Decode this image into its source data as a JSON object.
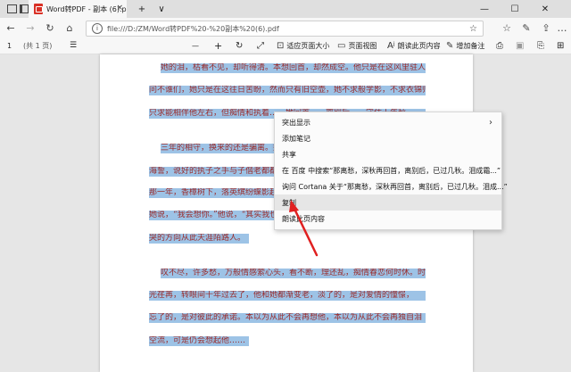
{
  "tabbar": {
    "tab_title": "Word转PDF - 副本 (6).p",
    "close_glyph": "×",
    "new_tab_glyph": "+",
    "dropdown_glyph": "∨",
    "minimize_glyph": "—",
    "maximize_glyph": "☐",
    "close_window_glyph": "✕"
  },
  "navbar": {
    "url": "file:///D:/ZM/Word转PDF%20-%20副本%20(6).pdf"
  },
  "pdf_toolbar": {
    "page_number": "1",
    "page_total": "(共 1 页)",
    "minus": "—",
    "plus": "+",
    "fit_page": "适应页面大小",
    "page_view": "页面视图",
    "read_aloud": "朗读此页内容",
    "add_note": "增加备注"
  },
  "document": {
    "lines": [
      "她的泪，枯看不见，却听得清。本想回首，却然成空。他只是在这风里驻人为",
      "问不谁们，她只是在这往日苦盼，然而只有旧空壶，她不求般学影，不求衣锦归，",
      "只求能相伴他左右，但痴情和执着……她回首……离别后……守住十年秋。",
      "三年的相守，换来的还是骗离。她离开之后，才发现其实那不是真正的遗忘，她",
      "海誓，说好的执子之手与子偕老都都成了空，到最后竟然成了她一个人的执念。",
      "那一年，香樟树下，落英缤纷蝶影起舞，他牵着她的手走过了一季的繁华……",
      "她说，“我会想你。”他说，“其实我也一样。”然后那一年……",
      "哭的方向从此天涯陌路人。",
      "叹不尽，许多愁，万般情感萦心头，看不断，理还乱，痴情春恋何时休。时",
      "光荏苒，转眼间十年过去了，他和她都渐变老，淡了的，是对爱情的憧憬，",
      "忘了的，是对彼此的承诺。本以为从此不会再想他，本以为从此不会再独自泪",
      "空流，可是仍会想起他……"
    ]
  },
  "context_menu": {
    "items": [
      "突出显示",
      "添加笔记",
      "共享",
      "在 百度 中搜索“那离愁，深秋再回首，离别后，已过几秋。泪成霜...”",
      "询问 Cortana 关于“那离愁，深秋再回首，离别后，已过几秋。泪成...”",
      "复制",
      "朗读此页内容"
    ],
    "chevron": "›"
  },
  "colors": {
    "highlight": "#9dc3e6",
    "text": "#9a2b2b",
    "arrow": "#e02020"
  }
}
